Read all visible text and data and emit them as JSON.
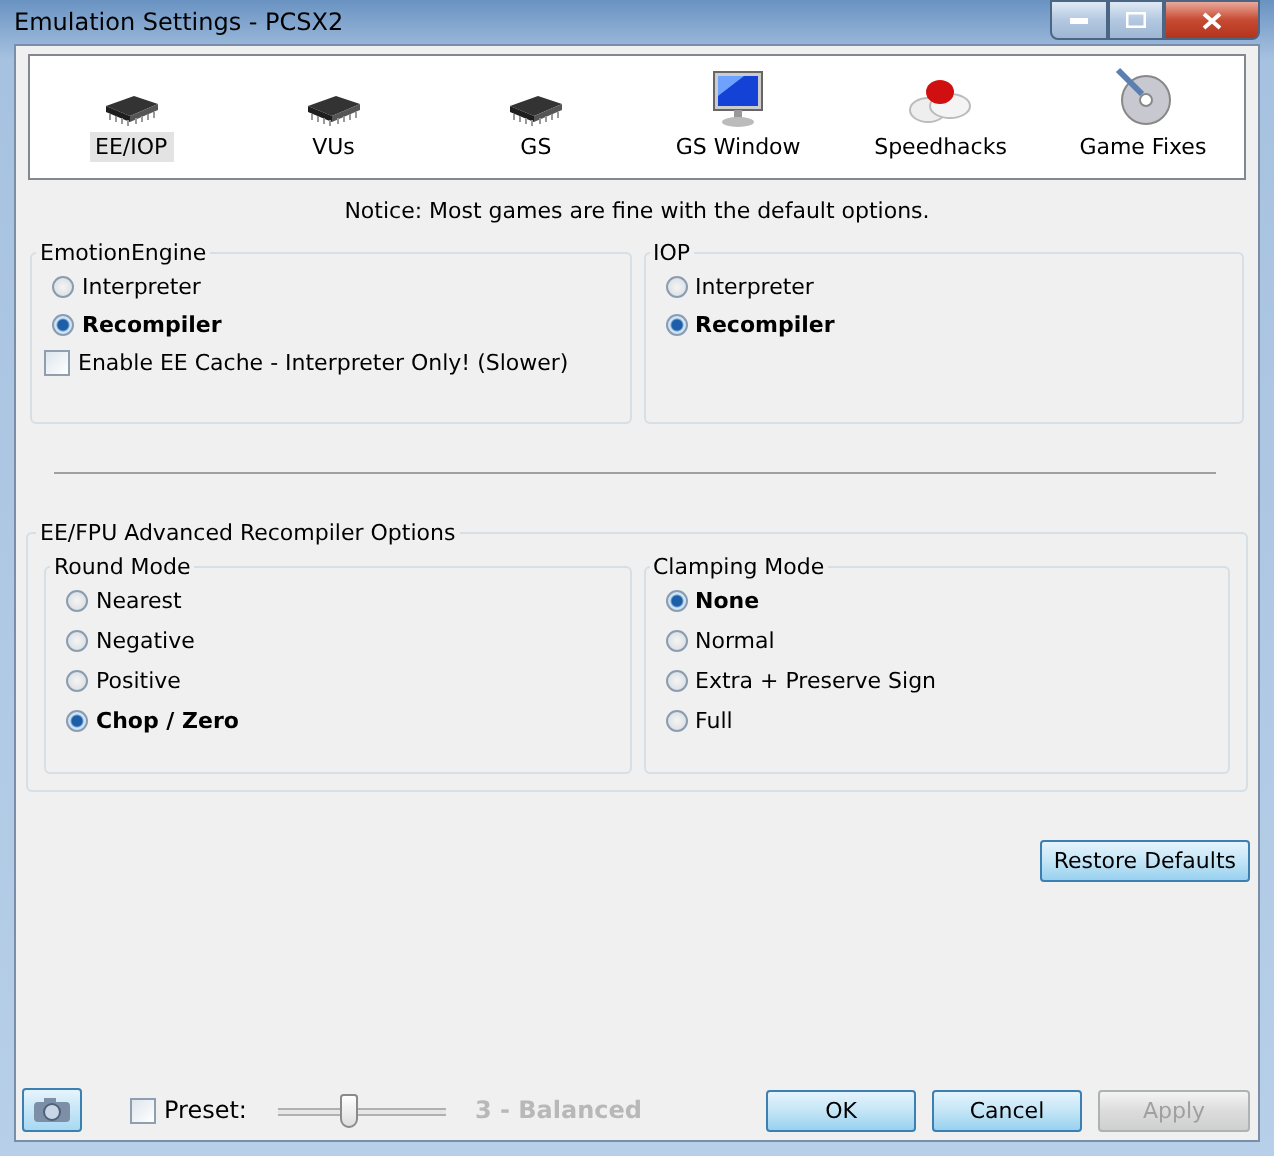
{
  "window": {
    "title": "Emulation Settings - PCSX2"
  },
  "tabs": [
    {
      "label": "EE/IOP",
      "kind": "chip",
      "selected": true
    },
    {
      "label": "VUs",
      "kind": "chip",
      "selected": false
    },
    {
      "label": "GS",
      "kind": "chip",
      "selected": false
    },
    {
      "label": "GS Window",
      "kind": "monitor",
      "selected": false
    },
    {
      "label": "Speedhacks",
      "kind": "pills",
      "selected": false
    },
    {
      "label": "Game Fixes",
      "kind": "disc",
      "selected": false
    }
  ],
  "notice": "Notice: Most games are fine with the default options.",
  "emotion_engine": {
    "title": "EmotionEngine",
    "options": [
      {
        "label": "Interpreter",
        "selected": false
      },
      {
        "label": "Recompiler",
        "selected": true
      }
    ],
    "cache": {
      "label": "Enable EE Cache - Interpreter Only! (Slower)",
      "checked": false
    }
  },
  "iop": {
    "title": "IOP",
    "options": [
      {
        "label": "Interpreter",
        "selected": false
      },
      {
        "label": "Recompiler",
        "selected": true
      }
    ]
  },
  "advanced": {
    "title": "EE/FPU Advanced Recompiler Options",
    "round_mode": {
      "title": "Round Mode",
      "options": [
        {
          "label": "Nearest",
          "selected": false
        },
        {
          "label": "Negative",
          "selected": false
        },
        {
          "label": "Positive",
          "selected": false
        },
        {
          "label": "Chop / Zero",
          "selected": true
        }
      ]
    },
    "clamping_mode": {
      "title": "Clamping Mode",
      "options": [
        {
          "label": "None",
          "selected": true
        },
        {
          "label": "Normal",
          "selected": false
        },
        {
          "label": "Extra + Preserve Sign",
          "selected": false
        },
        {
          "label": "Full",
          "selected": false
        }
      ]
    }
  },
  "restore_button": "Restore Defaults",
  "preset": {
    "label": "Preset:",
    "checked": false,
    "level": 0.42,
    "reading": "3 - Balanced",
    "disabled": true
  },
  "buttons": [
    {
      "label": "OK",
      "disabled": false
    },
    {
      "label": "Cancel",
      "disabled": false
    },
    {
      "label": "Apply",
      "disabled": true
    }
  ]
}
